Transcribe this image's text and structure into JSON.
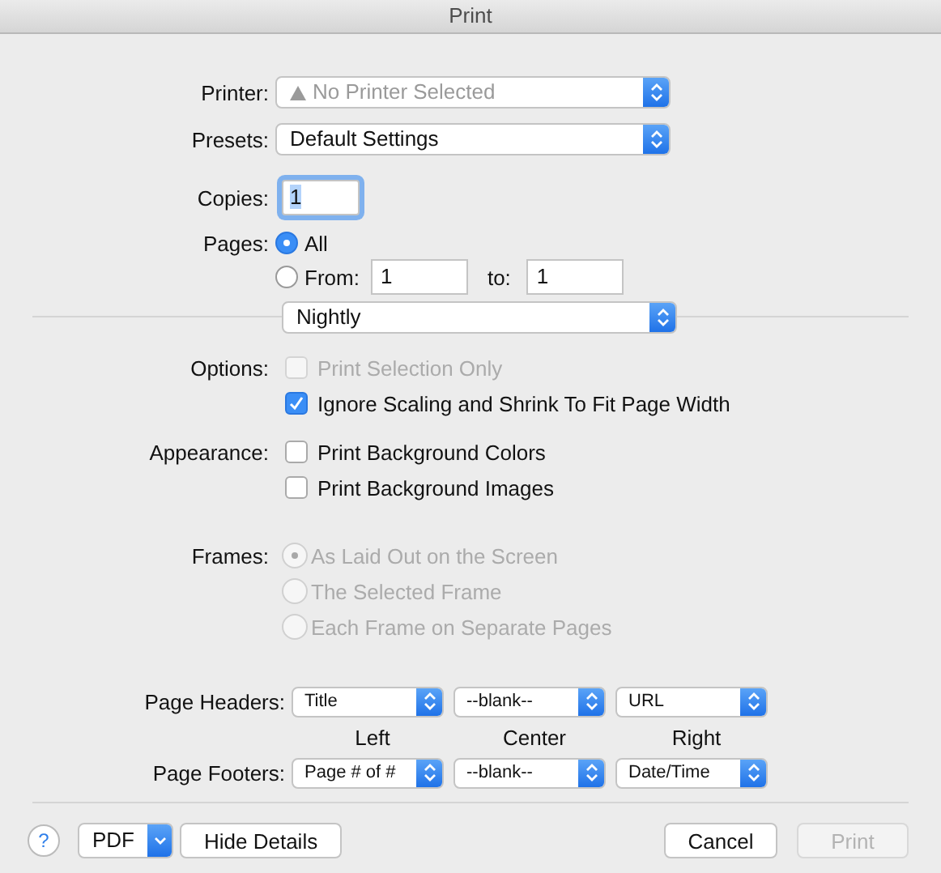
{
  "window": {
    "title": "Print"
  },
  "printer": {
    "label": "Printer:",
    "value": "No Printer Selected",
    "disabled": true,
    "warning": true
  },
  "presets": {
    "label": "Presets:",
    "value": "Default Settings"
  },
  "copies": {
    "label": "Copies:",
    "value": "1"
  },
  "pages": {
    "label": "Pages:",
    "all": {
      "label": "All",
      "selected": true
    },
    "range": {
      "label": "From:",
      "selected": false,
      "from": "1",
      "to_label": "to:",
      "to": "1"
    }
  },
  "panel": {
    "value": "Nightly"
  },
  "options": {
    "label": "Options:",
    "items": [
      {
        "label": "Print Selection Only",
        "checked": false,
        "disabled": true
      },
      {
        "label": "Ignore Scaling and Shrink To Fit Page Width",
        "checked": true,
        "disabled": false
      }
    ]
  },
  "appearance": {
    "label": "Appearance:",
    "items": [
      {
        "label": "Print Background Colors",
        "checked": false,
        "disabled": false
      },
      {
        "label": "Print Background Images",
        "checked": false,
        "disabled": false
      }
    ]
  },
  "frames": {
    "label": "Frames:",
    "disabled": true,
    "items": [
      {
        "label": "As Laid Out on the Screen",
        "selected": true
      },
      {
        "label": "The Selected Frame",
        "selected": false
      },
      {
        "label": "Each Frame on Separate Pages",
        "selected": false
      }
    ]
  },
  "headers": {
    "label": "Page Headers:",
    "values": [
      "Title",
      "--blank--",
      "URL"
    ]
  },
  "columns": [
    "Left",
    "Center",
    "Right"
  ],
  "footers": {
    "label": "Page Footers:",
    "values": [
      "Page # of #",
      "--blank--",
      "Date/Time"
    ]
  },
  "buttons": {
    "help": "?",
    "pdf": "PDF",
    "details": "Hide Details",
    "cancel": "Cancel",
    "print": {
      "label": "Print",
      "disabled": true
    }
  }
}
